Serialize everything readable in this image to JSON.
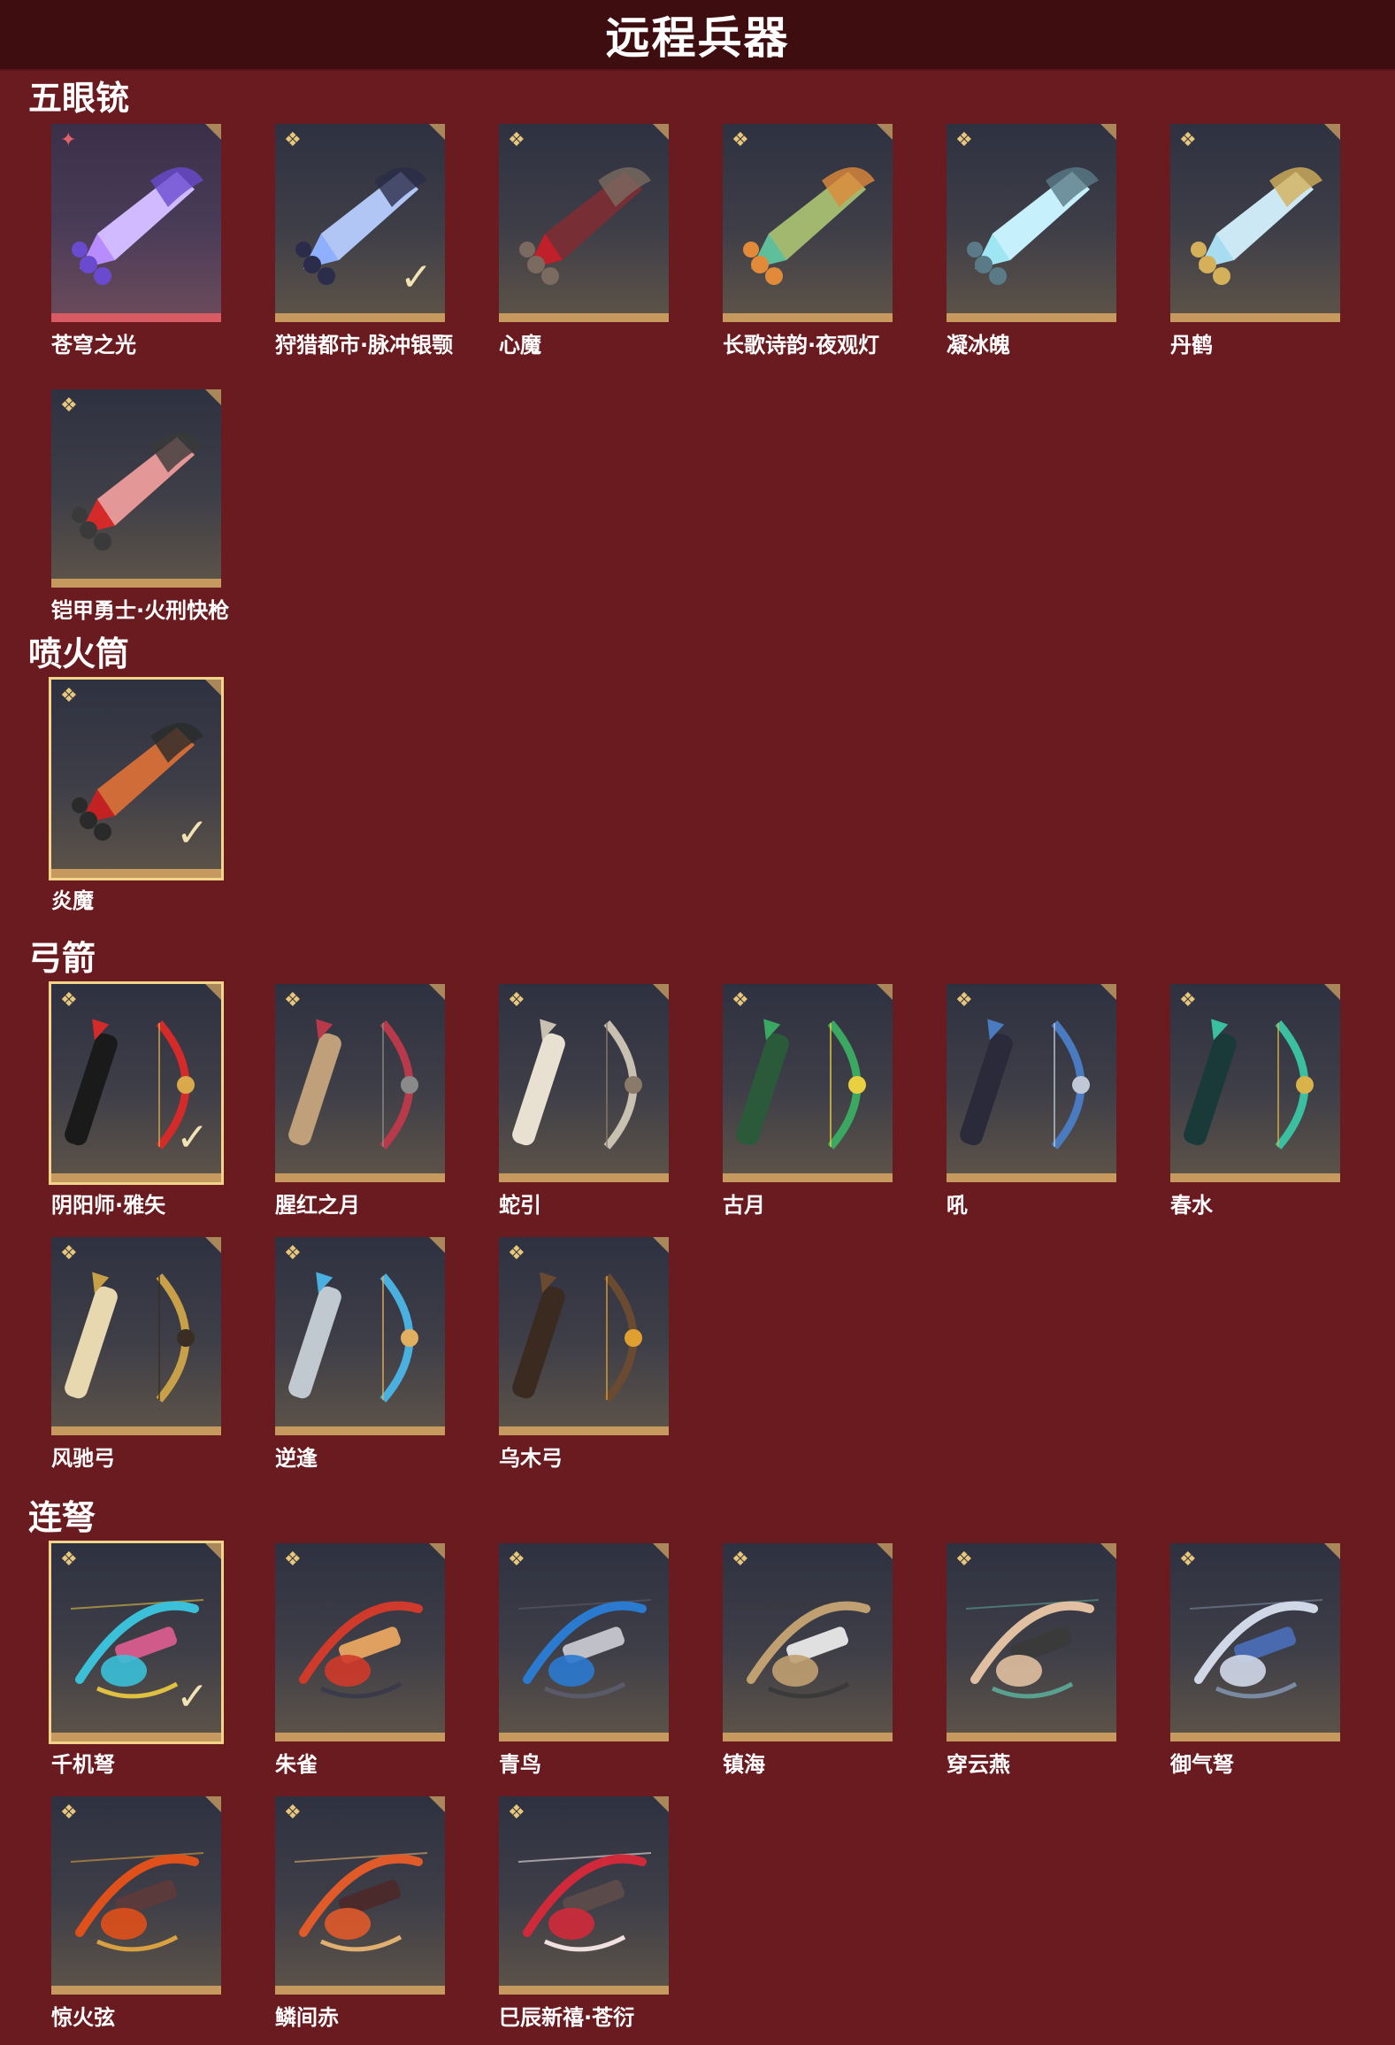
{
  "header": {
    "title": "远程兵器"
  },
  "colors": {
    "background": "#6a1b1f",
    "header_bg": "#3d0d0f",
    "card_accent": "#c69a5f",
    "rare_accent": "#d85a62",
    "selected_outline": "#f3d58a"
  },
  "sections": [
    {
      "title": "五眼铳",
      "items": [
        {
          "name": "苍穹之光",
          "rank_icon": "star-badge-icon",
          "art": "violet-crystal-gun",
          "selected": false,
          "checked": false,
          "rare": true
        },
        {
          "name": "狩猎都市·脉冲银颚",
          "rank_icon": "gold-rank-icon",
          "art": "silver-jaw-gun",
          "selected": false,
          "checked": true,
          "rare": false
        },
        {
          "name": "心魔",
          "rank_icon": "gold-rank-icon",
          "art": "demon-gun",
          "selected": false,
          "checked": false,
          "rare": false
        },
        {
          "name": "长歌诗韵·夜观灯",
          "rank_icon": "gold-rank-icon",
          "art": "jade-lantern-gun",
          "selected": false,
          "checked": false,
          "rare": false
        },
        {
          "name": "凝冰魄",
          "rank_icon": "gold-rank-icon",
          "art": "ice-gun",
          "selected": false,
          "checked": false,
          "rare": false
        },
        {
          "name": "丹鹤",
          "rank_icon": "gold-rank-icon",
          "art": "crane-gun",
          "selected": false,
          "checked": false,
          "rare": false
        },
        {
          "name": "铠甲勇士·火刑快枪",
          "rank_icon": "gold-rank-icon",
          "art": "red-armor-gun",
          "selected": false,
          "checked": false,
          "rare": false
        }
      ]
    },
    {
      "title": "喷火筒",
      "items": [
        {
          "name": "炎魔",
          "rank_icon": "gold-rank-icon",
          "art": "flame-cannon",
          "selected": true,
          "checked": true,
          "rare": false
        }
      ]
    },
    {
      "title": "弓箭",
      "items": [
        {
          "name": "阴阳师·雅矢",
          "rank_icon": "gold-rank-icon",
          "art": "red-quiver-bow",
          "selected": true,
          "checked": true,
          "rare": false
        },
        {
          "name": "腥红之月",
          "rank_icon": "gold-rank-icon",
          "art": "crimson-bow",
          "selected": false,
          "checked": false,
          "rare": false
        },
        {
          "name": "蛇引",
          "rank_icon": "gold-rank-icon",
          "art": "snake-bow",
          "selected": false,
          "checked": false,
          "rare": false
        },
        {
          "name": "古月",
          "rank_icon": "gold-rank-icon",
          "art": "jade-bow",
          "selected": false,
          "checked": false,
          "rare": false
        },
        {
          "name": "吼",
          "rank_icon": "gold-rank-icon",
          "art": "blue-tiger-bow",
          "selected": false,
          "checked": false,
          "rare": false
        },
        {
          "name": "春水",
          "rank_icon": "gold-rank-icon",
          "art": "teal-bow",
          "selected": false,
          "checked": false,
          "rare": false
        },
        {
          "name": "风驰弓",
          "rank_icon": "gold-rank-icon",
          "art": "gold-wind-bow",
          "selected": false,
          "checked": false,
          "rare": false
        },
        {
          "name": "逆逢",
          "rank_icon": "gold-rank-icon",
          "art": "azure-bow",
          "selected": false,
          "checked": false,
          "rare": false
        },
        {
          "name": "乌木弓",
          "rank_icon": "gold-rank-icon",
          "art": "ebony-bow",
          "selected": false,
          "checked": false,
          "rare": false
        }
      ]
    },
    {
      "title": "连弩",
      "items": [
        {
          "name": "千机弩",
          "rank_icon": "gold-rank-icon",
          "art": "rainbow-crossbow",
          "selected": true,
          "checked": true,
          "rare": false
        },
        {
          "name": "朱雀",
          "rank_icon": "gold-rank-icon",
          "art": "phoenix-crossbow",
          "selected": false,
          "checked": false,
          "rare": false
        },
        {
          "name": "青鸟",
          "rank_icon": "gold-rank-icon",
          "art": "bluebird-crossbow",
          "selected": false,
          "checked": false,
          "rare": false
        },
        {
          "name": "镇海",
          "rank_icon": "gold-rank-icon",
          "art": "sea-crossbow",
          "selected": false,
          "checked": false,
          "rare": false
        },
        {
          "name": "穿云燕",
          "rank_icon": "gold-rank-icon",
          "art": "swallow-crossbow",
          "selected": false,
          "checked": false,
          "rare": false
        },
        {
          "name": "御气弩",
          "rank_icon": "gold-rank-icon",
          "art": "silver-crossbow",
          "selected": false,
          "checked": false,
          "rare": false
        },
        {
          "name": "惊火弦",
          "rank_icon": "gold-rank-icon",
          "art": "fire-crossbow",
          "selected": false,
          "checked": false,
          "rare": false
        },
        {
          "name": "鳞间赤",
          "rank_icon": "gold-rank-icon",
          "art": "koi-crossbow",
          "selected": false,
          "checked": false,
          "rare": false
        },
        {
          "name": "巳辰新禧·苍衍",
          "rank_icon": "gold-rank-icon",
          "art": "dragon-crossbow",
          "selected": false,
          "checked": false,
          "rare": false
        }
      ]
    }
  ]
}
